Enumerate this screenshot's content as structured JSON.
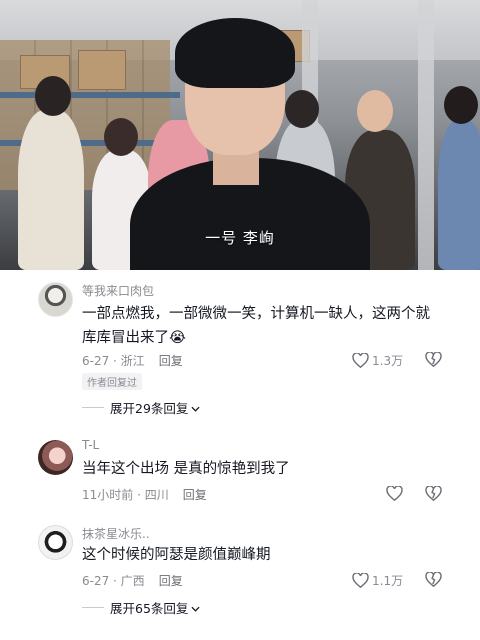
{
  "video": {
    "caption": "一号 李峋"
  },
  "comments": [
    {
      "username": "等我来口肉包",
      "text": "一部点燃我，一部微微一笑，计算机一缺人，这两个就库库冒出来了😭",
      "date": "6-27 · 浙江",
      "reply_label": "回复",
      "likes": "1.3万",
      "badge": "作者回复过",
      "expand_label": "展开29条回复"
    },
    {
      "username": "T-L",
      "text": "当年这个出场 是真的惊艳到我了",
      "date": "11小时前 · 四川",
      "reply_label": "回复",
      "likes": ""
    },
    {
      "username": "抹茶星冰乐..",
      "text": "这个时候的阿瑟是颜值巅峰期",
      "date": "6-27 · 广西",
      "reply_label": "回复",
      "likes": "1.1万",
      "expand_label": "展开65条回复"
    }
  ],
  "icons": {
    "like": "heart-outline-icon",
    "dislike": "broken-heart-icon",
    "expand": "chevron-down-icon"
  }
}
